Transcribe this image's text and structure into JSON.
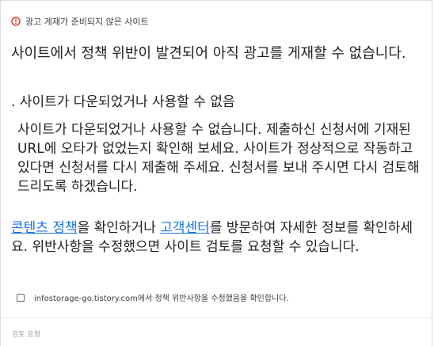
{
  "header": {
    "icon": "alert-circle-icon",
    "icon_color": "#d93025",
    "text": "광고 게재가 준비되지 않은 사이트"
  },
  "title": "사이트에서 정책 위반이 발견되어 아직 광고를 게재할 수 없습니다.",
  "reason": {
    "bullet": ".",
    "title": "사이트가 다운되었거나 사용할 수 없음",
    "description": "사이트가 다운되었거나 사용할 수 없습니다. 제출하신 신청서에 기재된 URL에 오타가 없었는지 확인해 보세요. 사이트가 정상적으로 작동하고 있다면 신청서를 다시 제출해 주세요. 신청서를 보내 주시면 다시 검토해 드리도록 하겠습니다."
  },
  "info": {
    "link_policy": "콘텐츠 정책",
    "text_1": "을 확인하거나 ",
    "link_help": "고객센터",
    "text_2": "를 방문하여 자세한 정보를 확인하세요. 위반사항을 수정했으면 사이트 검토를 요청할 수 있습니다.",
    "link_color": "#1a73e8"
  },
  "confirm": {
    "label": "infostorage-go.tistory.com에서 정책 위반사항을 수정했음을 확인합니다.",
    "checked": false
  },
  "footer": {
    "request_review_label": "검토 요청"
  }
}
